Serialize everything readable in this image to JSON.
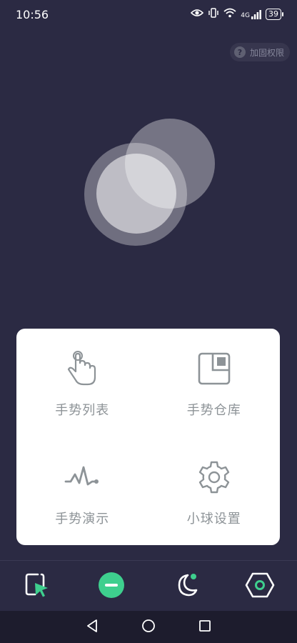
{
  "status": {
    "time": "10:56",
    "signal": "4G",
    "battery": "39"
  },
  "permission": {
    "label": "加固权限"
  },
  "menu": {
    "items": [
      {
        "label": "手势列表",
        "icon": "hand-pointer-icon"
      },
      {
        "label": "手势仓库",
        "icon": "gesture-store-icon"
      },
      {
        "label": "手势演示",
        "icon": "gesture-wave-icon"
      },
      {
        "label": "小球设置",
        "icon": "gear-icon"
      }
    ]
  },
  "nav": {
    "items": [
      {
        "icon": "select-cursor-icon"
      },
      {
        "icon": "minus-circle-icon",
        "accent": "#3ecf8e"
      },
      {
        "icon": "moon-icon"
      },
      {
        "icon": "hexagon-settings-icon"
      }
    ]
  },
  "colors": {
    "background": "#2b2a43",
    "accent": "#3ecf8e",
    "card": "#ffffff",
    "label": "#8d9397"
  }
}
